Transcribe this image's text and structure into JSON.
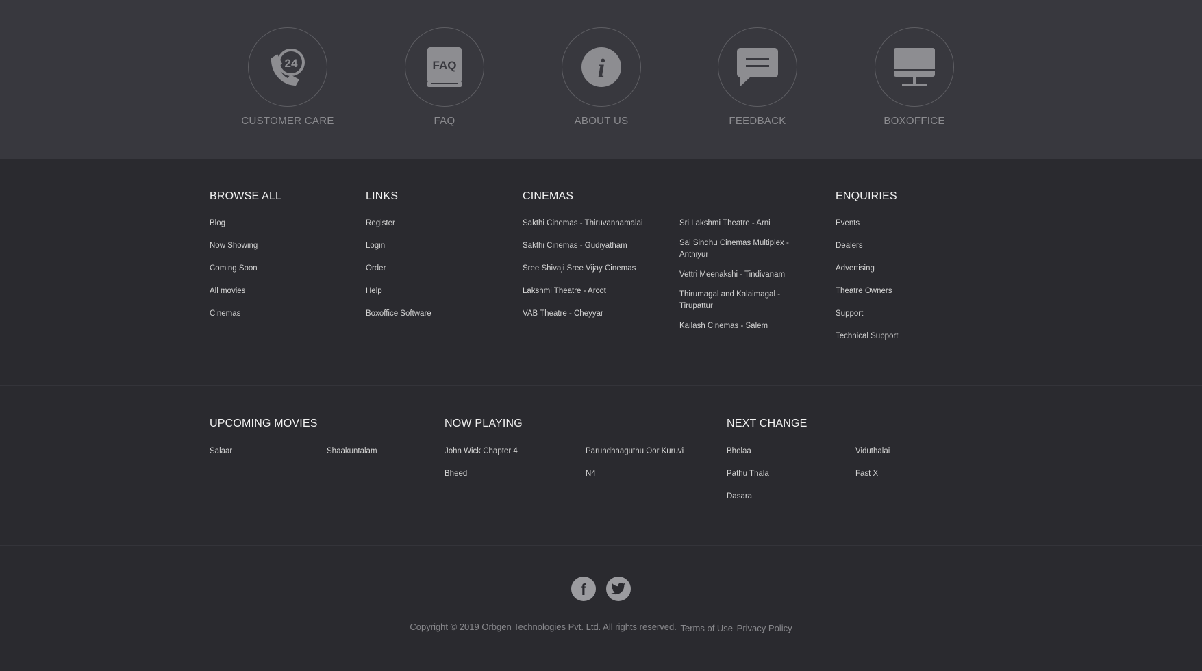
{
  "quick_links": [
    {
      "label": "CUSTOMER CARE",
      "icon": "phone-24-icon",
      "icon_text": "24"
    },
    {
      "label": "FAQ",
      "icon": "faq-book-icon",
      "icon_text": "FAQ"
    },
    {
      "label": "ABOUT US",
      "icon": "info-icon",
      "icon_text": "i"
    },
    {
      "label": "FEEDBACK",
      "icon": "chat-bubble-icon"
    },
    {
      "label": "BOXOFFICE",
      "icon": "monitor-icon"
    }
  ],
  "browse_all": {
    "title": "BROWSE ALL",
    "items": [
      "Blog",
      "Now Showing",
      "Coming Soon",
      "All movies",
      "Cinemas"
    ]
  },
  "links": {
    "title": "LINKS",
    "items": [
      "Register",
      "Login",
      "Order",
      "Help",
      "Boxoffice Software"
    ]
  },
  "cinemas": {
    "title": "CINEMAS",
    "col1": [
      "Sakthi Cinemas - Thiruvannamalai",
      "Sakthi Cinemas - Gudiyatham",
      "Sree Shivaji Sree Vijay Cinemas",
      "Lakshmi Theatre - Arcot",
      "VAB Theatre - Cheyyar"
    ],
    "col2": [
      "Sri Lakshmi Theatre - Arni",
      "Sai Sindhu Cinemas Multiplex - Anthiyur",
      "Vettri Meenakshi - Tindivanam",
      "Thirumagal and Kalaimagal - Tirupattur",
      "Kailash Cinemas - Salem"
    ]
  },
  "enquiries": {
    "title": "ENQUIRIES",
    "items": [
      "Events",
      "Dealers",
      "Advertising",
      "Theatre Owners",
      "Support",
      "Technical Support"
    ]
  },
  "upcoming_movies": {
    "title": "UPCOMING MOVIES",
    "col1": [
      "Salaar"
    ],
    "col2": [
      "Shaakuntalam"
    ]
  },
  "now_playing": {
    "title": "NOW PLAYING",
    "col1": [
      "John Wick Chapter 4",
      "Bheed"
    ],
    "col2": [
      "Parundhaaguthu Oor Kuruvi",
      "N4"
    ]
  },
  "next_change": {
    "title": "NEXT CHANGE",
    "col1": [
      "Bholaa",
      "Pathu Thala",
      "Dasara"
    ],
    "col2": [
      "Viduthalai",
      "Fast X"
    ]
  },
  "social": [
    {
      "name": "facebook-icon",
      "glyph": "f"
    },
    {
      "name": "twitter-icon"
    }
  ],
  "footer": {
    "copyright": "Copyright © 2019 Orbgen Technologies Pvt. Ltd. All rights reserved.",
    "terms": "Terms of Use",
    "privacy": "Privacy Policy"
  },
  "colors": {
    "top_band": "#38383e",
    "page_bg": "#2a2a2f",
    "icon_fill": "#8d8d91",
    "muted_text": "#8b8b8f"
  }
}
